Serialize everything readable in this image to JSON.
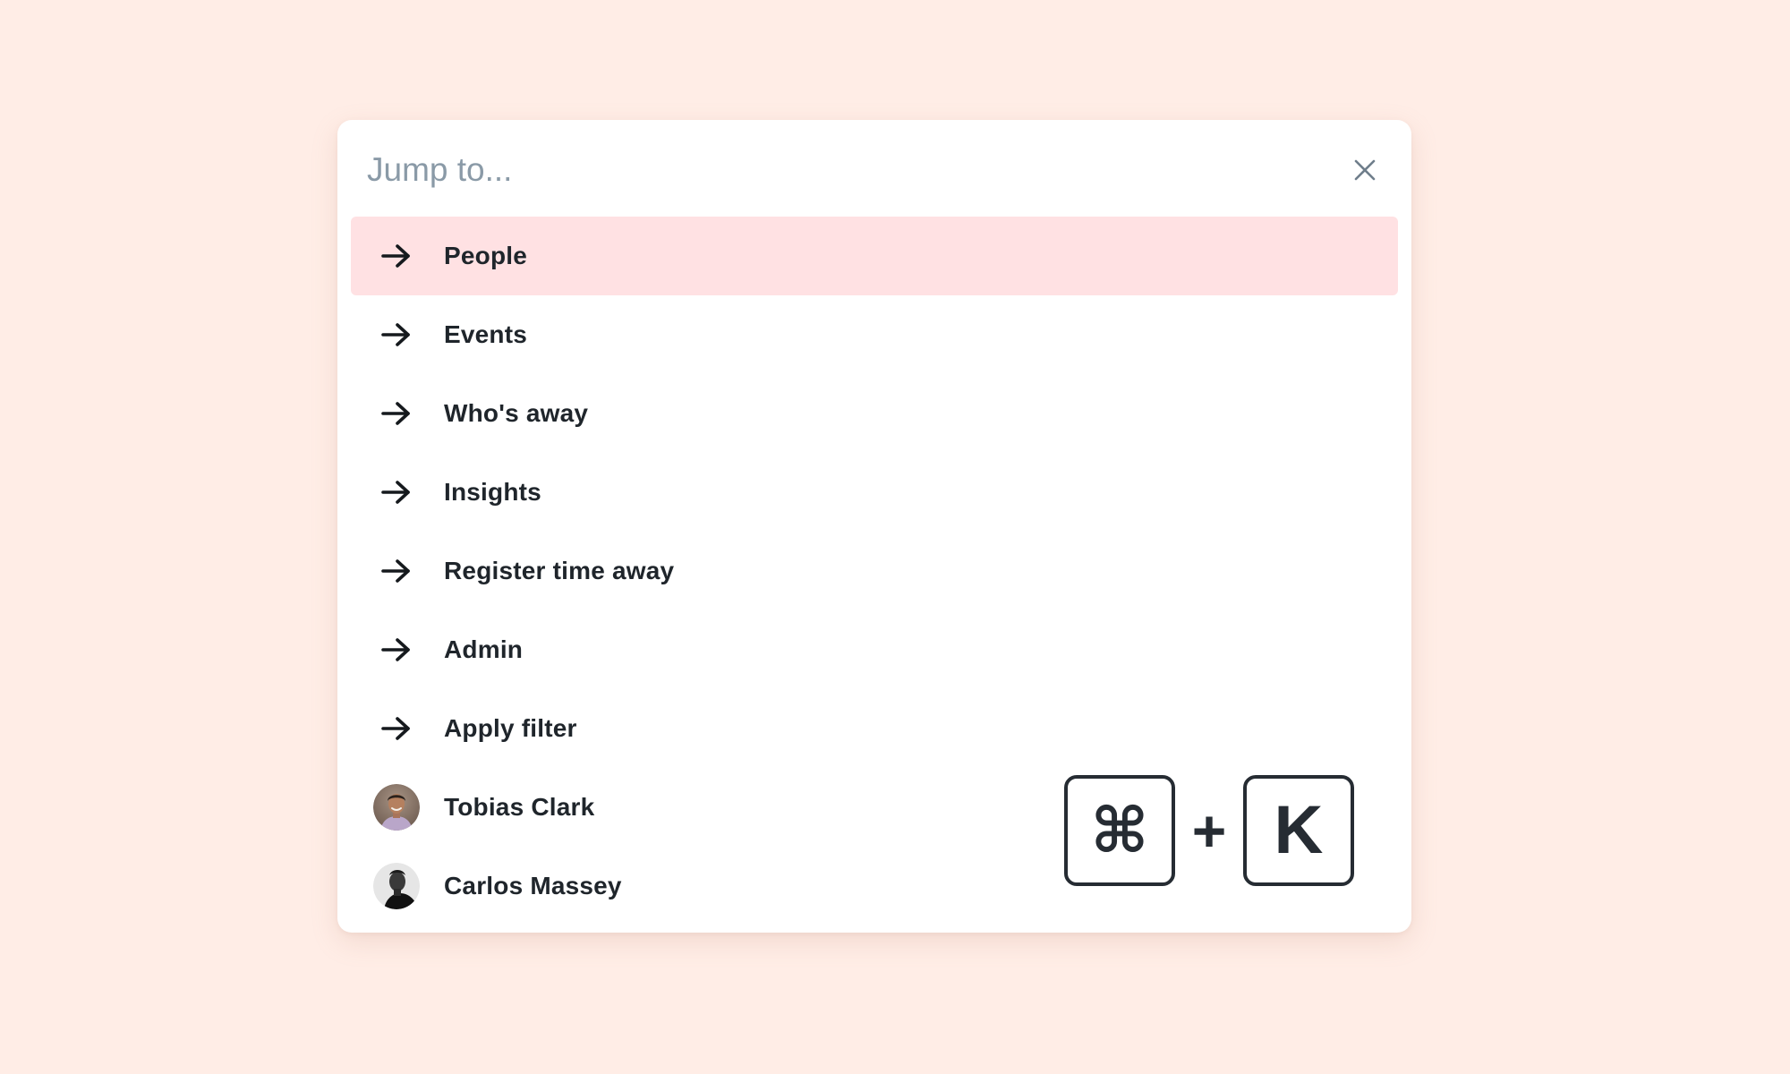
{
  "search": {
    "placeholder": "Jump to...",
    "value": ""
  },
  "close_icon": "close-icon",
  "results": [
    {
      "label": "People",
      "icon": "arrow-right-icon",
      "selected": true
    },
    {
      "label": "Events",
      "icon": "arrow-right-icon",
      "selected": false
    },
    {
      "label": "Who's away",
      "icon": "arrow-right-icon",
      "selected": false
    },
    {
      "label": "Insights",
      "icon": "arrow-right-icon",
      "selected": false
    },
    {
      "label": "Register time away",
      "icon": "arrow-right-icon",
      "selected": false
    },
    {
      "label": "Admin",
      "icon": "arrow-right-icon",
      "selected": false
    },
    {
      "label": "Apply filter",
      "icon": "arrow-right-icon",
      "selected": false
    },
    {
      "label": "Tobias Clark",
      "icon": "avatar",
      "selected": false
    },
    {
      "label": "Carlos Massey",
      "icon": "avatar",
      "selected": false
    }
  ],
  "shortcut": {
    "modifier": "⌘",
    "plus": "+",
    "key": "K"
  },
  "colors": {
    "background": "#ffede6",
    "selected_row": "#ffe1e3",
    "text": "#1f252b",
    "placeholder": "#8a9aa7"
  }
}
